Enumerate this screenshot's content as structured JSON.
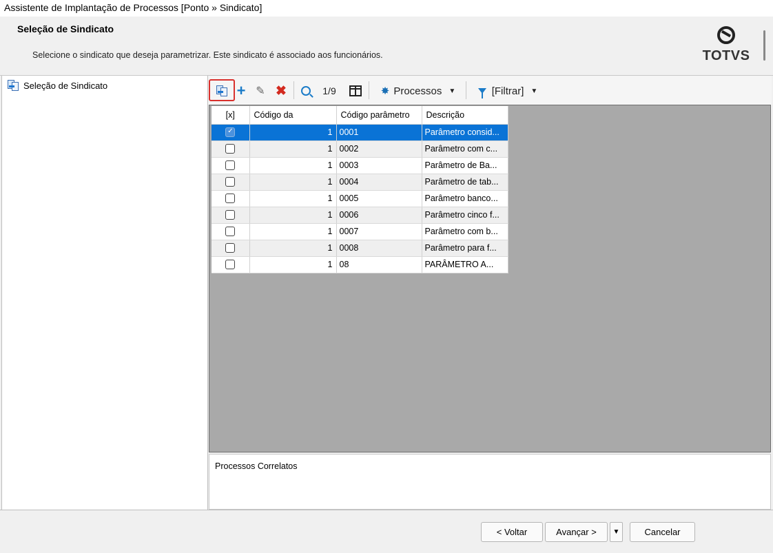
{
  "window": {
    "title": "Assistente de Implantação de Processos [Ponto » Sindicato]"
  },
  "header": {
    "title": "Seleção de Sindicato",
    "description": "Selecione o sindicato que deseja parametrizar. Este sindicato é associado aos funcionários.",
    "logo_text": "TOTVS"
  },
  "tree": {
    "items": [
      {
        "label": "Seleção de Sindicato",
        "icon": "documents-icon"
      }
    ]
  },
  "toolbar": {
    "record_position": "1/9",
    "processes_label": "Processos",
    "filter_label": "[Filtrar]"
  },
  "grid": {
    "columns": [
      "[x]",
      "Código da",
      "Código parâmetro",
      "Descrição"
    ],
    "rows": [
      {
        "checked": true,
        "codigo_da": "1",
        "codigo_parametro": "0001",
        "descricao": "Parâmetro consid..."
      },
      {
        "checked": false,
        "codigo_da": "1",
        "codigo_parametro": "0002",
        "descricao": "Parâmetro com c..."
      },
      {
        "checked": false,
        "codigo_da": "1",
        "codigo_parametro": "0003",
        "descricao": "Parâmetro de Ba..."
      },
      {
        "checked": false,
        "codigo_da": "1",
        "codigo_parametro": "0004",
        "descricao": "Parâmetro de tab..."
      },
      {
        "checked": false,
        "codigo_da": "1",
        "codigo_parametro": "0005",
        "descricao": "Parâmetro banco..."
      },
      {
        "checked": false,
        "codigo_da": "1",
        "codigo_parametro": "0006",
        "descricao": "Parâmetro cinco f..."
      },
      {
        "checked": false,
        "codigo_da": "1",
        "codigo_parametro": "0007",
        "descricao": "Parâmetro com b..."
      },
      {
        "checked": false,
        "codigo_da": "1",
        "codigo_parametro": "0008",
        "descricao": "Parâmetro para f..."
      },
      {
        "checked": false,
        "codigo_da": "1",
        "codigo_parametro": "08",
        "descricao": "PARÂMETRO A..."
      }
    ]
  },
  "related": {
    "label": "Processos Correlatos"
  },
  "footer": {
    "back_label": "< Voltar",
    "next_label": "Avançar >",
    "cancel_label": "Cancelar"
  },
  "colors": {
    "selection": "#0a73d6",
    "accent": "#1a7bc8",
    "delete": "#d32a1f",
    "highlight": "#d9302d"
  }
}
